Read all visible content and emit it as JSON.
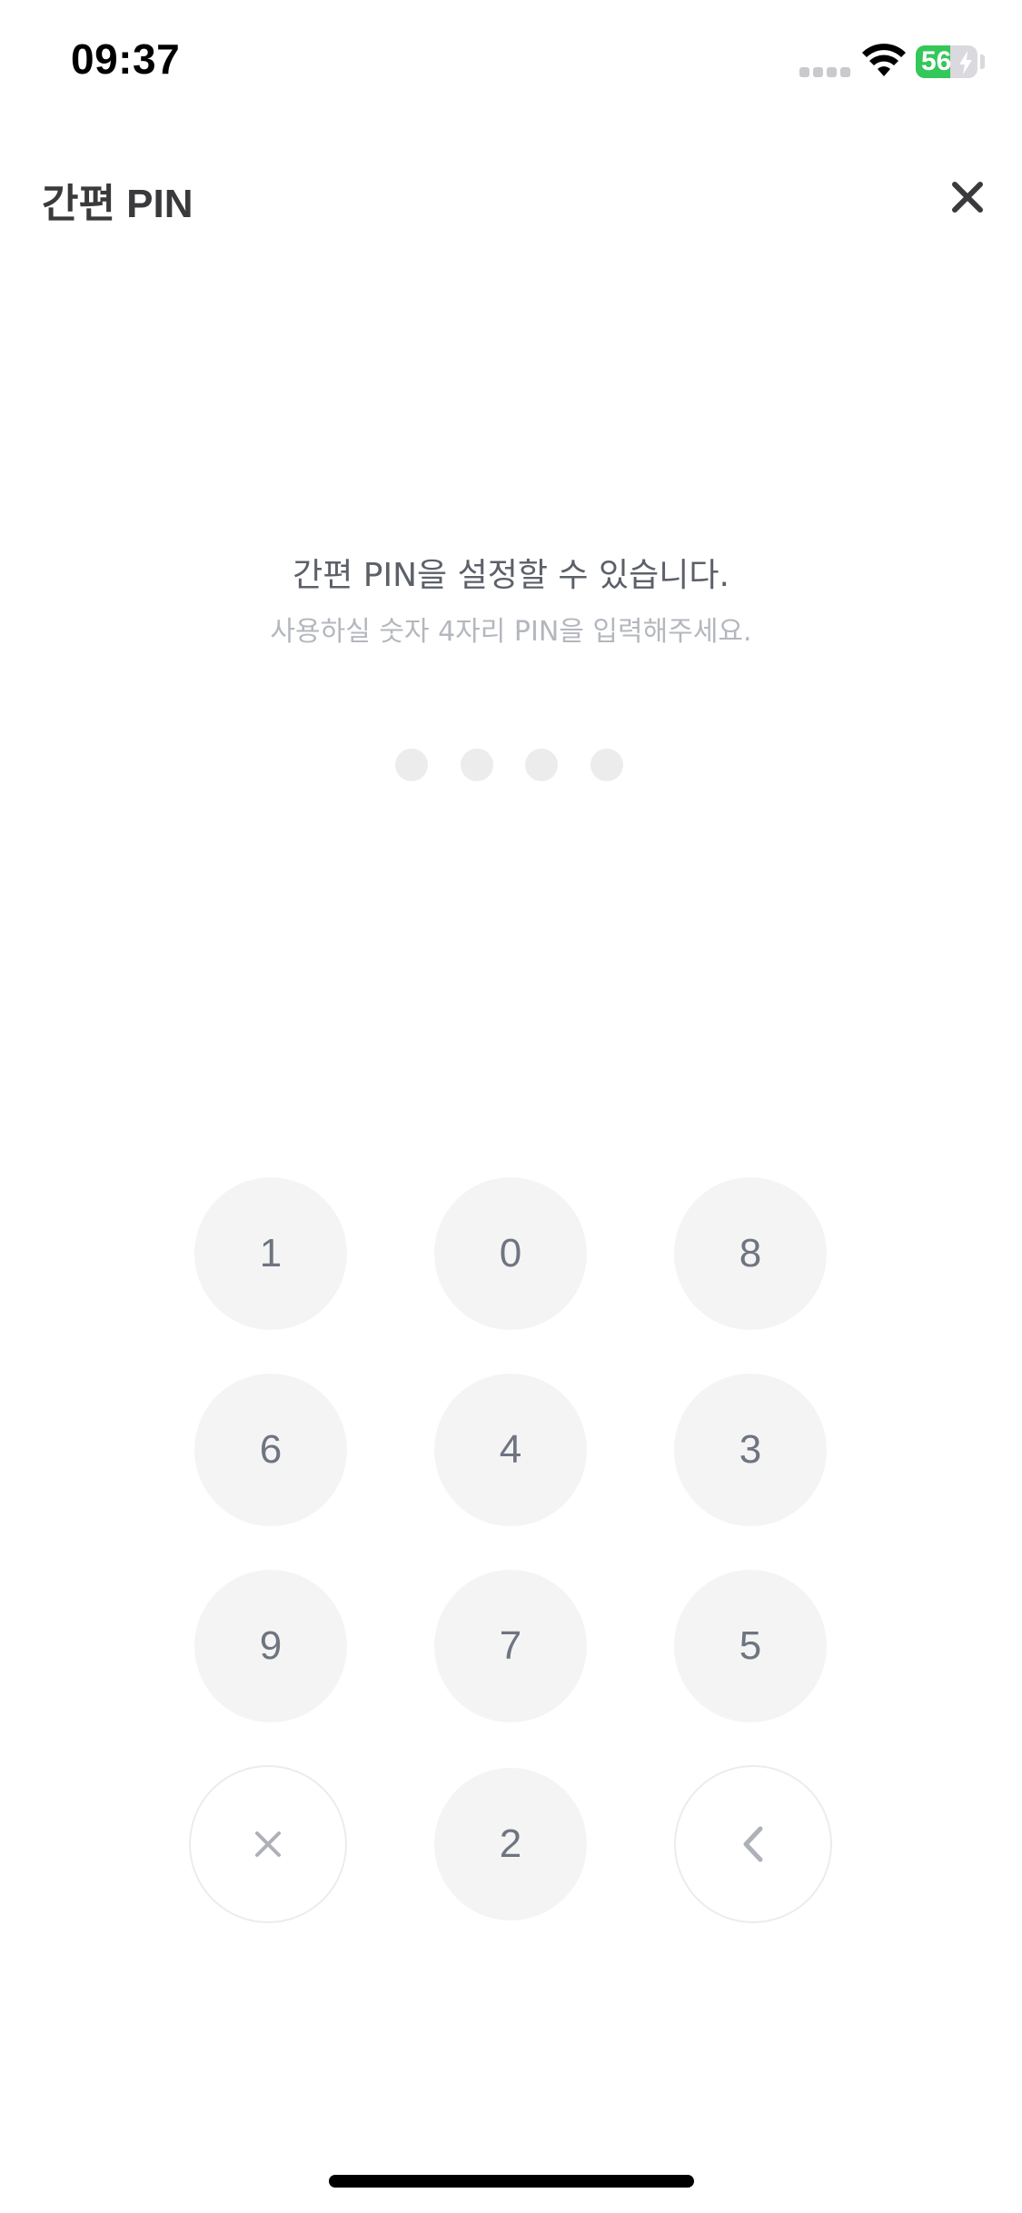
{
  "status_bar": {
    "time": "09:37",
    "battery_level": "56",
    "battery_fraction": 0.56,
    "battery_color": "#34c759",
    "icons": [
      "cellular-signal-icon",
      "wifi-icon",
      "battery-icon",
      "charging-bolt-icon"
    ]
  },
  "header": {
    "title": "간편 PIN",
    "close_icon": "close-icon"
  },
  "message": {
    "headline": "간편 PIN을 설정할 수 있습니다.",
    "subline": "사용하실 숫자 4자리 PIN을 입력해주세요."
  },
  "pin": {
    "length": 4,
    "entered": 0
  },
  "keypad": {
    "keys": [
      "1",
      "0",
      "8",
      "6",
      "4",
      "3",
      "9",
      "7",
      "5",
      "2"
    ],
    "clear_icon": "clear-x-icon",
    "backspace_icon": "chevron-left-icon"
  },
  "colors": {
    "key_background": "#f4f4f5",
    "key_text": "#6e7480",
    "dot_empty": "#ececec"
  }
}
